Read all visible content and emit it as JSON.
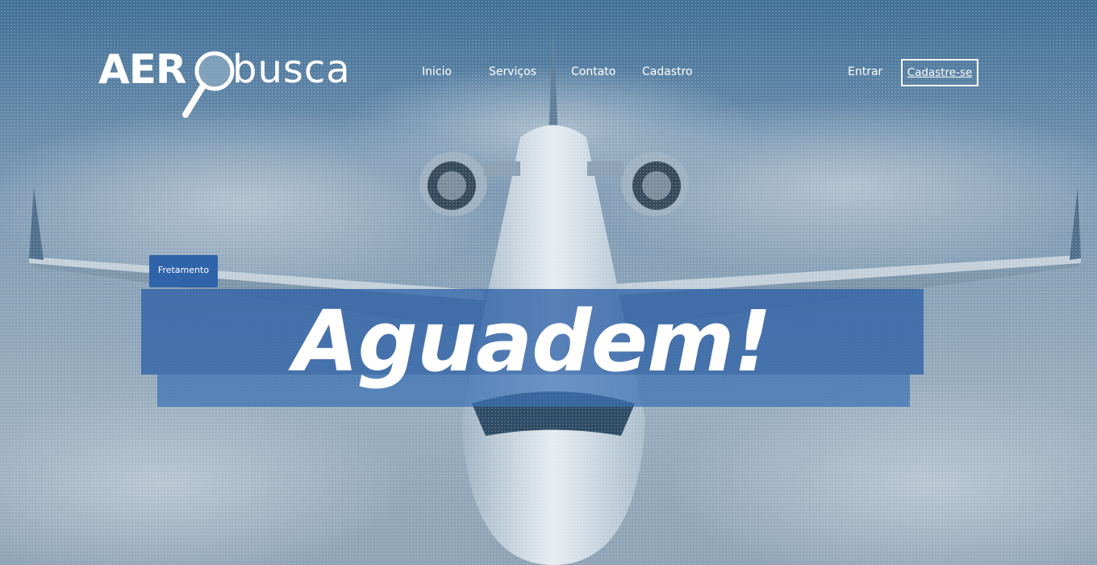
{
  "brand": {
    "logo_bold": "AER",
    "logo_light": "busca"
  },
  "nav": {
    "items": [
      "Inicio",
      "Serviços",
      "Contato",
      "Cadastro"
    ],
    "login": "Entrar",
    "signup": "Cadastre-se"
  },
  "hero": {
    "badge": "Fretamento",
    "headline": "Aguadem!"
  },
  "colors": {
    "accent": "#2f64aa",
    "banner": "#3a6fb0",
    "text": "#ffffff"
  }
}
